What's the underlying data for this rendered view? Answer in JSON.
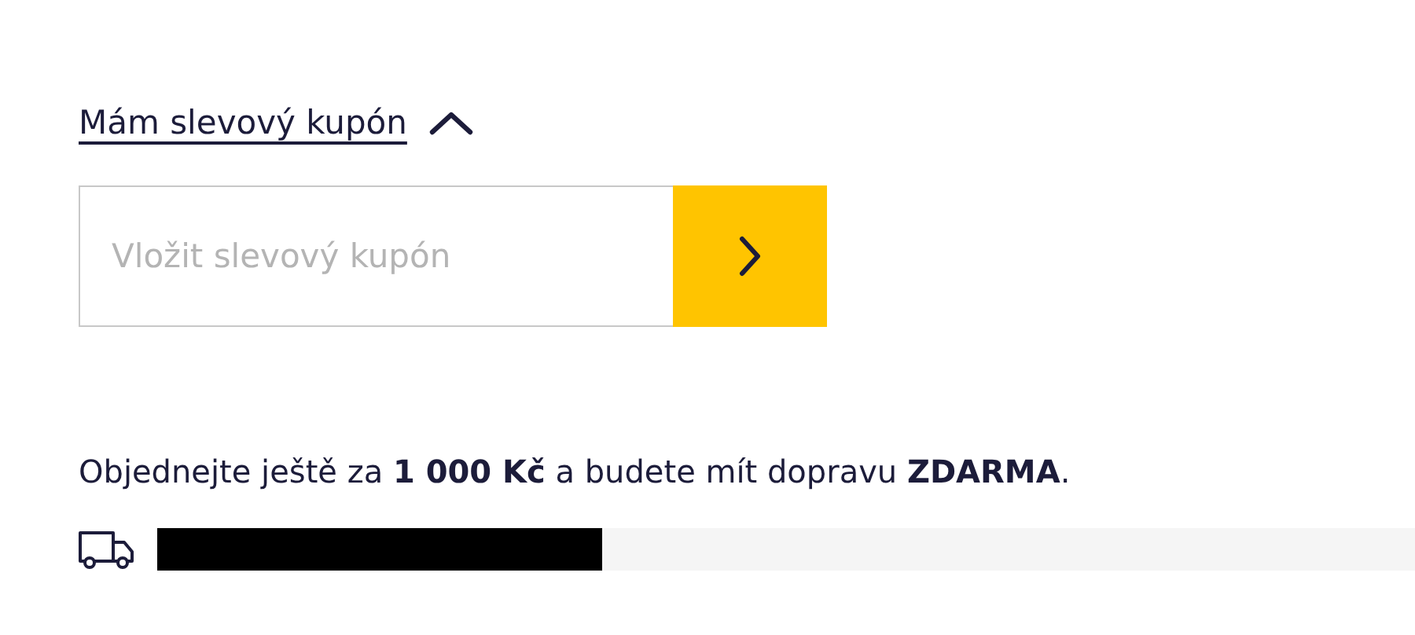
{
  "coupon": {
    "toggle_label": "Mám slevový kupón",
    "expanded": true,
    "placeholder": "Vložit slevový kupón"
  },
  "shipping": {
    "message": "Objednejte ještě za **1 000 Kč** a budete mít dopravu **ZDARMA**.",
    "level": 0.354
  }
}
